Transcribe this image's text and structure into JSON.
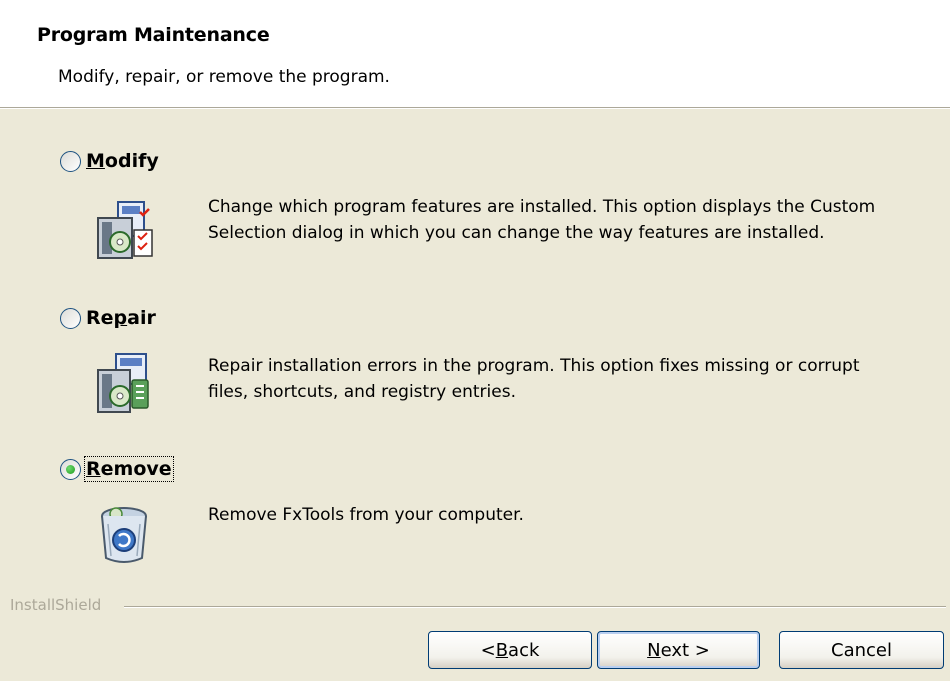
{
  "header": {
    "title": "Program Maintenance",
    "subtitle": "Modify, repair, or remove the program."
  },
  "options": {
    "modify": {
      "label_pre": "",
      "label_accel": "M",
      "label_post": "odify",
      "description": "Change which program features are installed. This option displays the Custom Selection dialog in which you can change the way features are installed.",
      "selected": false
    },
    "repair": {
      "label_pre": "Re",
      "label_accel": "p",
      "label_post": "air",
      "description": "Repair installation errors in the program. This option fixes missing or corrupt files, shortcuts, and registry entries.",
      "selected": false
    },
    "remove": {
      "label_pre": "",
      "label_accel": "R",
      "label_post": "emove",
      "description": "Remove FxTools from your computer.",
      "selected": true
    }
  },
  "footer": {
    "brand": "InstallShield"
  },
  "buttons": {
    "back": {
      "pre": "< ",
      "accel": "B",
      "post": "ack"
    },
    "next": {
      "pre": "",
      "accel": "N",
      "post": "ext >"
    },
    "cancel": "Cancel"
  }
}
